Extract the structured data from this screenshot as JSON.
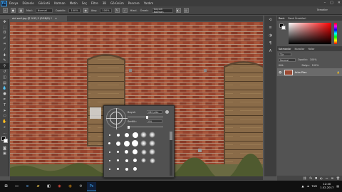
{
  "app": {
    "logo": "Ps"
  },
  "menu": [
    "Dosya",
    "Düzenle",
    "Görüntü",
    "Katman",
    "Metin",
    "Seç",
    "Filtre",
    "3B",
    "Görünüm",
    "Pencere",
    "Yardım"
  ],
  "window_controls": [
    "–",
    "▢",
    "✕"
  ],
  "options": {
    "mode_label": "Mod:",
    "mode_value": "Normal",
    "opacity_label": "Opaklık:",
    "opacity_value": "100%",
    "flow_label": "Akış:",
    "flow_value": "100%",
    "sample_label": "Örnek:",
    "sample_value": "Geçerli Katman",
    "align_label": "Hizal.",
    "workspace": "Temeller"
  },
  "document": {
    "tab_title": "old wall.jpg @ %33,3 (RGB/8) *",
    "close": "×"
  },
  "brush_popup": {
    "size_label": "Boyut:",
    "size_value": "280 piks",
    "hardness_label": "Sertlik:",
    "hardness_value": "0%",
    "size_fraction": 0.55,
    "hardness_fraction": 0.0
  },
  "panels": {
    "color_tabs": [
      "Renk",
      "Renk Örnekleri"
    ],
    "layer_tabs": [
      "Katmanlar",
      "Kanallar",
      "Yollar"
    ],
    "kind_label": "Tür",
    "blend_label": "Normal",
    "opacity_label": "Opaklık:",
    "opacity_value": "100%",
    "lock_label": "Kilit:",
    "fill_label": "Dolgu:",
    "fill_value": "100%",
    "layer_name": "Arka Plan"
  },
  "taskbar": {
    "time": "12:40",
    "date": "1.02.2017",
    "lang": "TUR"
  },
  "colors": {
    "accent": "#3fa9f5",
    "brick": "#a04a33",
    "door": "#8b6f4e"
  }
}
